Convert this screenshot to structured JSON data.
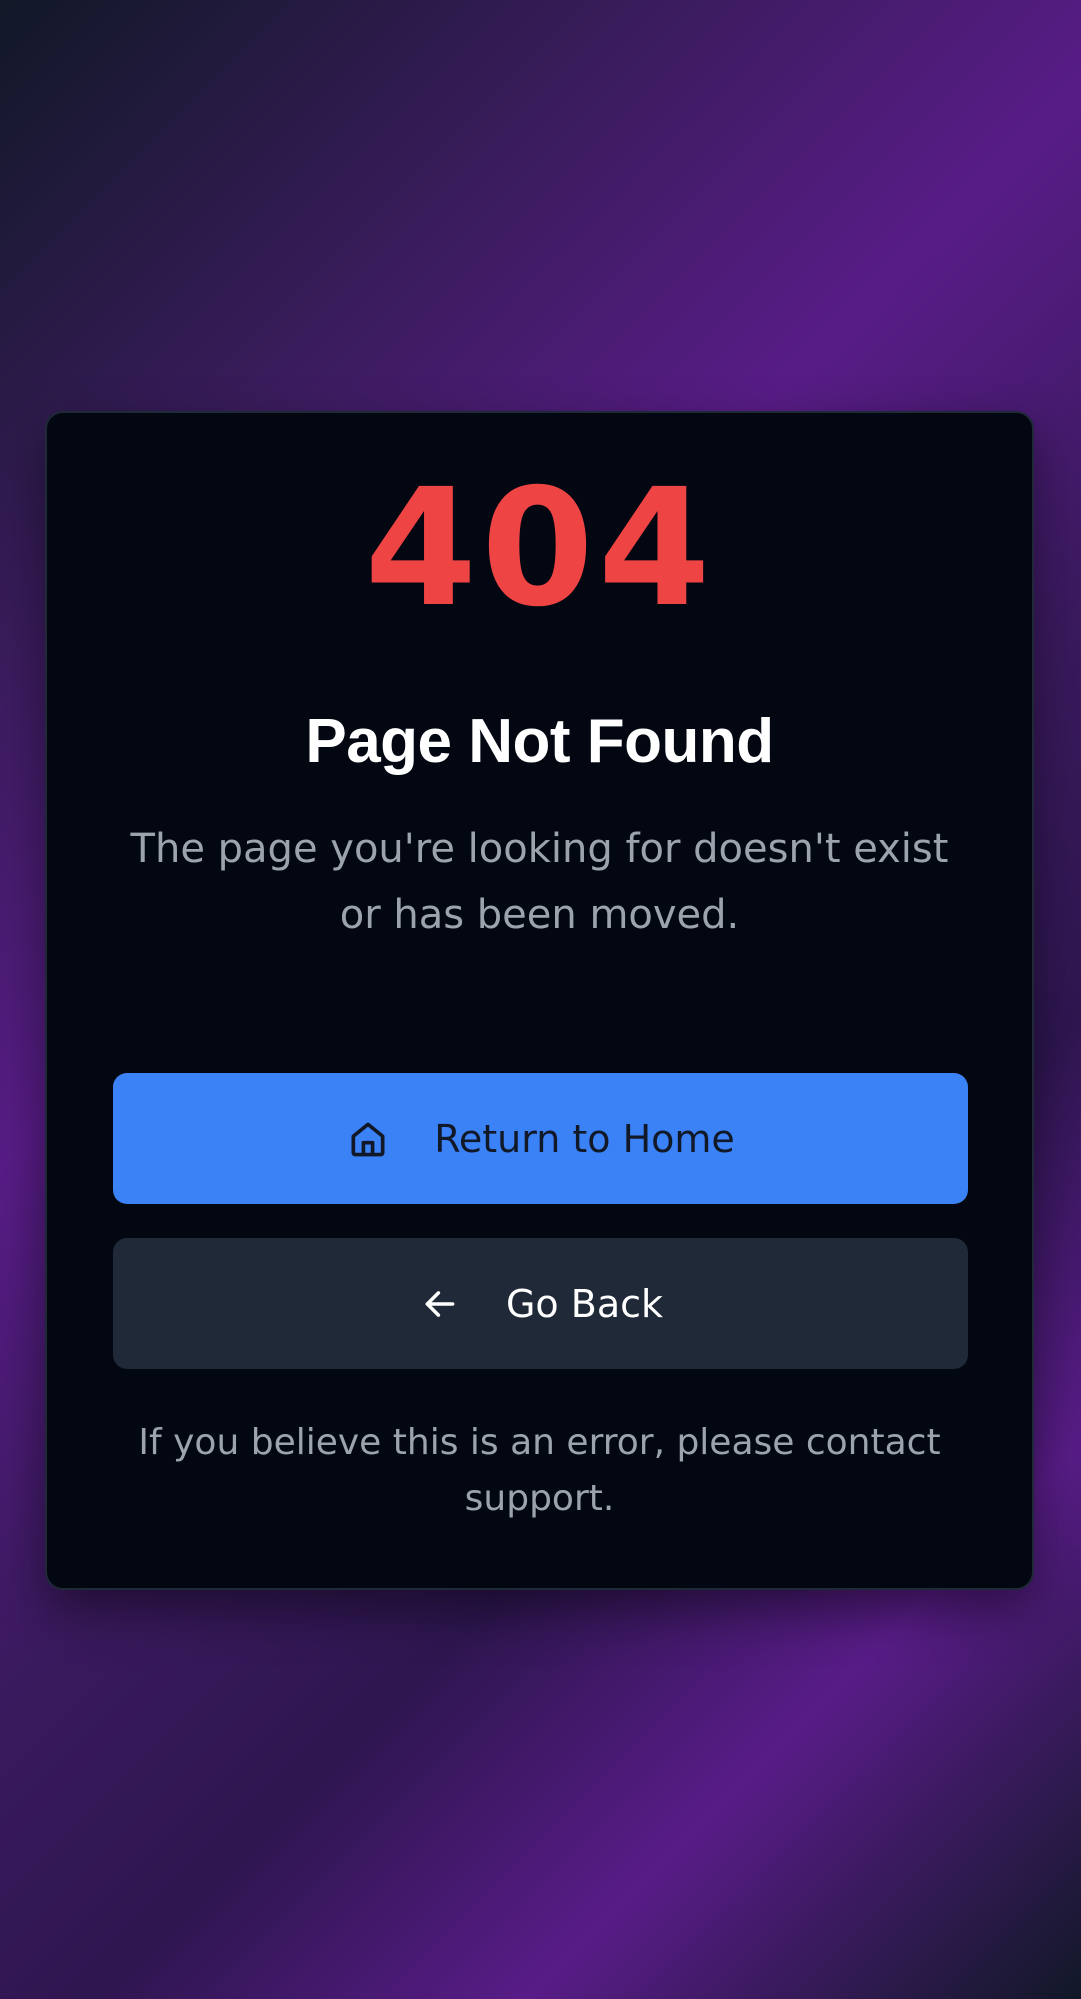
{
  "error": {
    "code": "404",
    "title": "Page Not Found",
    "description": "The page you're looking for doesn't exist or has been moved."
  },
  "actions": {
    "home": {
      "label": "Return to Home",
      "icon": "home-icon"
    },
    "back": {
      "label": "Go Back",
      "icon": "arrow-left-icon"
    }
  },
  "footer": {
    "note": "If you believe this is an error, please contact support."
  },
  "colors": {
    "accent": "#3b82f6",
    "error": "#ef4444",
    "card": "#030712",
    "secondary_button": "#1f2937",
    "muted_text": "#9ca3af",
    "background_purple": "#581c87",
    "background_dark": "#111827"
  }
}
